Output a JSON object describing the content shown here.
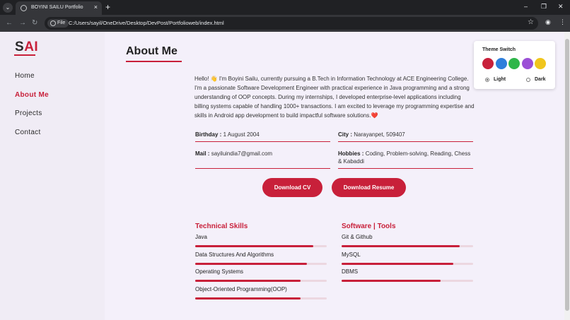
{
  "browser": {
    "tab_menu": "⌄",
    "tab_title": "BOYINI SAILU Portfolio",
    "tab_close": "×",
    "new_tab": "+",
    "window_controls": [
      "–",
      "❐",
      "✕"
    ],
    "nav": {
      "back": "←",
      "forward": "→",
      "reload": "↻"
    },
    "file_chip": "File",
    "url": "C:/Users/sayil/OneDrive/Desktop/DevPost/Portfolioweb/index.html",
    "star": "☆",
    "profile_icon": "◉",
    "menu_icon": "⋮"
  },
  "logo": {
    "part1": "S",
    "part2": "AI"
  },
  "nav": [
    {
      "label": "Home",
      "active": false
    },
    {
      "label": "About Me",
      "active": true
    },
    {
      "label": "Projects",
      "active": false
    },
    {
      "label": "Contact",
      "active": false
    }
  ],
  "about": {
    "title": "About Me",
    "text": "Hello! 👋 I'm Boyini Sailu, currently pursuing a B.Tech in Information Technology at ACE Engineering College. I'm a passionate Software Development Engineer with practical experience in Java programming and a strong understanding of OOP concepts. During my internships, I developed enterprise-level applications including billing systems capable of handling 1000+ transactions. I am excited to leverage my programming expertise and skills in Android app development to build impactful software solutions.❤️"
  },
  "info": {
    "birthday_label": "Birthday :",
    "birthday_value": "1 August 2004",
    "city_label": "City :",
    "city_value": "Narayanpet, 509407",
    "mail_label": "Mail :",
    "mail_value": "sayiluindia7@gmail.com",
    "hobbies_label": "Hobbies :",
    "hobbies_value": "Coding, Problem-solving, Reading, Chess & Kabaddi"
  },
  "buttons": {
    "cv": "Download CV",
    "resume": "Download Resume"
  },
  "skills": {
    "technical_title": "Technical Skills",
    "technical": [
      {
        "name": "Java",
        "level": 0.9
      },
      {
        "name": "Data Structures And Algorithms",
        "level": 0.85
      },
      {
        "name": "Operating Systems",
        "level": 0.8
      },
      {
        "name": "Object-Oriented Programming(OOP)",
        "level": 0.8
      }
    ],
    "software_title": "Software | Tools",
    "software": [
      {
        "name": "Git & Github",
        "level": 0.9
      },
      {
        "name": "MySQL",
        "level": 0.85
      },
      {
        "name": "DBMS",
        "level": 0.75
      }
    ]
  },
  "theme": {
    "title": "Theme Switch",
    "colors": [
      "#c8203a",
      "#2f7fdb",
      "#2fb64a",
      "#9b4fd6",
      "#f0c51c"
    ],
    "light_label": "Light",
    "dark_label": "Dark",
    "selected": "light"
  }
}
